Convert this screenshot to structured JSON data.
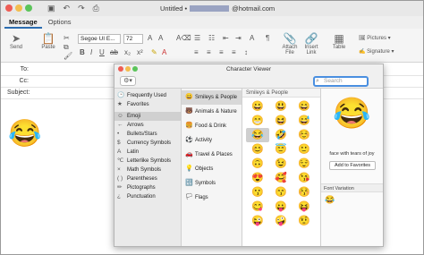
{
  "window": {
    "title": "Untitled •",
    "email_suffix": "@hotmail.com",
    "colors": {
      "close": "#ee5d55",
      "min": "#f3bd4f",
      "max": "#5bc45a"
    }
  },
  "titlebar": {
    "icons": [
      "save-icon",
      "undo-icon",
      "redo-icon",
      "print-icon"
    ]
  },
  "tabs": [
    "Message",
    "Options"
  ],
  "ribbon": {
    "send": "Send",
    "paste": "Paste",
    "font": "Segoe UI E...",
    "size": "72",
    "attach": "Attach\nFile",
    "link": "Insert\nLink",
    "table": "Table",
    "pictures": "Pictures",
    "signature": "Signature"
  },
  "fields": {
    "to": "To:",
    "cc": "Cc:",
    "subject": "Subject:"
  },
  "body_emoji": "😂",
  "char_viewer": {
    "title": "Character Viewer",
    "search_placeholder": "Search",
    "categories": [
      "Frequently Used",
      "Favorites",
      "Emoji",
      "Arrows",
      "Bullets/Stars",
      "Currency Symbols",
      "Latin",
      "Letterlike Symbols",
      "Math Symbols",
      "Parentheses",
      "Pictographs",
      "Punctuation"
    ],
    "category_icons": [
      "🕒",
      "★",
      "☺",
      "←",
      "•",
      "$",
      "A",
      "℃",
      "×",
      "( )",
      "✏",
      "¿"
    ],
    "subcategories": [
      "Smileys & People",
      "Animals & Nature",
      "Food & Drink",
      "Activity",
      "Travel & Places",
      "Objects",
      "Symbols",
      "Flags"
    ],
    "subcategory_icons": [
      "😀",
      "🐻",
      "🍔",
      "⚽",
      "🚗",
      "💡",
      "🔣",
      "🏳"
    ],
    "grid_header": "Smileys & People",
    "emojis": [
      "😀",
      "😃",
      "😄",
      "😁",
      "😆",
      "😅",
      "😂",
      "🤣",
      "☺️",
      "😊",
      "😇",
      "🙂",
      "🙃",
      "😉",
      "😌",
      "😍",
      "🥰",
      "😘",
      "😗",
      "😙",
      "😚",
      "😋",
      "😛",
      "😝",
      "😜",
      "🤪",
      "🤨"
    ],
    "selected_emoji": "😂",
    "selected_name": "face with tears of joy",
    "add_favorites": "Add to Favorites",
    "font_variation": "Font Variation",
    "variation_emoji": "😂"
  }
}
